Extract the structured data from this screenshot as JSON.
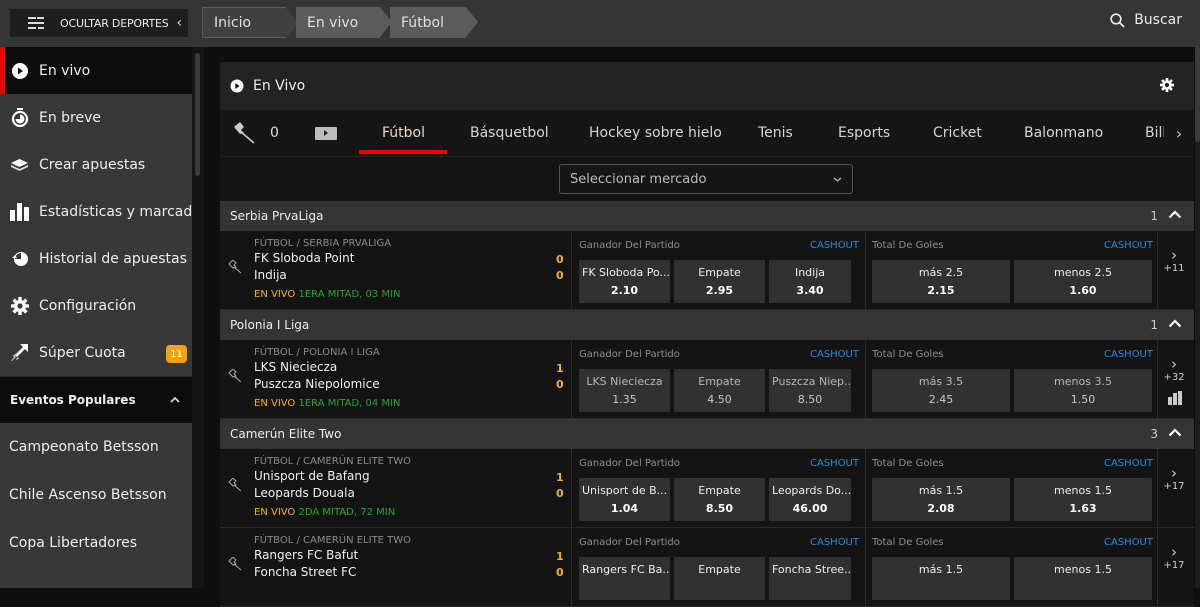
{
  "topbar": {
    "hide_sports_label": "OCULTAR DEPORTES",
    "breadcrumbs": [
      "Inicio",
      "En vivo",
      "Fútbol"
    ],
    "search_label": "Buscar"
  },
  "sidebar": {
    "items": [
      {
        "label": "En vivo",
        "icon": "play-circle-icon",
        "active": true
      },
      {
        "label": "En breve",
        "icon": "stopwatch-icon"
      },
      {
        "label": "Crear apuestas",
        "icon": "bet-builder-icon"
      },
      {
        "label": "Estadísticas y marcador",
        "icon": "bar-chart-icon"
      },
      {
        "label": "Historial de apuestas",
        "icon": "history-icon"
      },
      {
        "label": "Configuración",
        "icon": "gear-icon"
      },
      {
        "label": "Súper Cuota",
        "icon": "rocket-arrow-icon",
        "badge": "11"
      }
    ],
    "popular_title": "Eventos Populares",
    "popular": [
      "Campeonato Betsson",
      "Chile Ascenso Betsson",
      "Copa Libertadores"
    ]
  },
  "panel": {
    "title": "En Vivo",
    "pinned_count": "0",
    "tabs": [
      "Fútbol",
      "Básquetbol",
      "Hockey sobre hielo",
      "Tenis",
      "Esports",
      "Cricket",
      "Balonmano",
      "Bill"
    ],
    "active_tab": "Fútbol",
    "market_placeholder": "Seleccionar mercado"
  },
  "colors": {
    "accent": "#e00000",
    "live": "#f5b400",
    "time": "#1eaa32",
    "cashout": "#1f8de0"
  },
  "leagues": [
    {
      "name": "Serbia PrvaLiga",
      "count": "1",
      "events": [
        {
          "path": "FÚTBOL / SERBIA PRVALIGA",
          "team1": "FK Sloboda Point",
          "team2": "Indija",
          "score1": "0",
          "score2": "0",
          "live": "EN VIVO",
          "time": "1ERA MITAD, 03 MIN",
          "m1_title": "Ganador Del Partido",
          "cashout": "CASHOUT",
          "m1": [
            {
              "n": "FK Sloboda Po...",
              "p": "2.10"
            },
            {
              "n": "Empate",
              "p": "2.95"
            },
            {
              "n": "Indija",
              "p": "3.40"
            }
          ],
          "m2_title": "Total De Goles",
          "m2": [
            {
              "n": "más 2.5",
              "p": "2.15"
            },
            {
              "n": "menos 2.5",
              "p": "1.60"
            }
          ],
          "more": "+11",
          "dim": false,
          "stats": false
        }
      ]
    },
    {
      "name": "Polonia I Liga",
      "count": "1",
      "events": [
        {
          "path": "FÚTBOL / POLONIA I LIGA",
          "team1": "LKS Nieciecza",
          "team2": "Puszcza Niepolomice",
          "score1": "1",
          "score2": "0",
          "live": "EN VIVO",
          "time": "1ERA MITAD, 04 MIN",
          "m1_title": "Ganador Del Partido",
          "cashout": "CASHOUT",
          "m1": [
            {
              "n": "LKS Nieciecza",
              "p": "1.35"
            },
            {
              "n": "Empate",
              "p": "4.50"
            },
            {
              "n": "Puszcza Niep...",
              "p": "8.50"
            }
          ],
          "m2_title": "Total De Goles",
          "m2": [
            {
              "n": "más 3.5",
              "p": "2.45"
            },
            {
              "n": "menos 3.5",
              "p": "1.50"
            }
          ],
          "more": "+32",
          "dim": true,
          "stats": true
        }
      ]
    },
    {
      "name": "Camerún Elite Two",
      "count": "3",
      "events": [
        {
          "path": "FÚTBOL / CAMERÚN ELITE TWO",
          "team1": "Unisport de Bafang",
          "team2": "Leopards Douala",
          "score1": "1",
          "score2": "0",
          "live": "EN VIVO",
          "time": "2DA MITAD, 72 MIN",
          "m1_title": "Ganador Del Partido",
          "cashout": "CASHOUT",
          "m1": [
            {
              "n": "Unisport de B...",
              "p": "1.04"
            },
            {
              "n": "Empate",
              "p": "8.50"
            },
            {
              "n": "Leopards Do...",
              "p": "46.00"
            }
          ],
          "m2_title": "Total De Goles",
          "m2": [
            {
              "n": "más 1.5",
              "p": "2.08"
            },
            {
              "n": "menos 1.5",
              "p": "1.63"
            }
          ],
          "more": "+17",
          "dim": false,
          "stats": false
        },
        {
          "path": "FÚTBOL / CAMERÚN ELITE TWO",
          "team1": "Rangers FC Bafut",
          "team2": "Foncha Street FC",
          "score1": "1",
          "score2": "0",
          "live": "",
          "time": "",
          "m1_title": "Ganador Del Partido",
          "cashout": "CASHOUT",
          "m1": [
            {
              "n": "Rangers FC Ba...",
              "p": ""
            },
            {
              "n": "Empate",
              "p": ""
            },
            {
              "n": "Foncha Stree...",
              "p": ""
            }
          ],
          "m2_title": "Total De Goles",
          "m2": [
            {
              "n": "más 1.5",
              "p": ""
            },
            {
              "n": "menos 1.5",
              "p": ""
            }
          ],
          "more": "+17",
          "dim": false,
          "stats": false
        }
      ]
    }
  ]
}
